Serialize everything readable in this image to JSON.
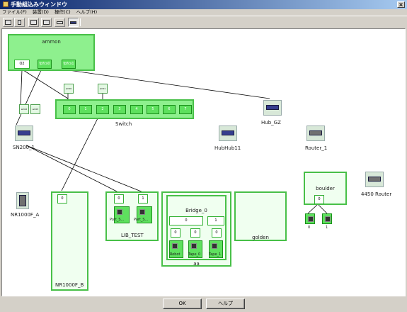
{
  "window": {
    "title": "手動組込みウィンドウ",
    "close": "×"
  },
  "menu": [
    "ファイル(F)",
    "装置(D)",
    "操作(C)",
    "ヘルプ(H)"
  ],
  "toolbar_icons": [
    "move-tool-icon",
    "pause-tool-icon",
    "list-tool-icon",
    "drive-tool-icon",
    "cartridge-tool-icon",
    "library-tool-icon"
  ],
  "diagram": {
    "ammon": {
      "label": "ammon",
      "ports": [
        "O2",
        "fpfcs0",
        "fpfcs1"
      ]
    },
    "switch": {
      "label": "Switch",
      "ports": [
        "0",
        "1",
        "2",
        "3",
        "4",
        "5",
        "6",
        "7"
      ]
    },
    "hub_gz": "Hub_GZ",
    "hubhub11": "HubHub11",
    "router_1": "Router_1",
    "sn200": "SN200_1",
    "boulder": {
      "label": "boulder",
      "port": "0",
      "child_ports": [
        "0",
        "1"
      ]
    },
    "router_4450": "4450 Router",
    "nr1000f_a": "NR1000F_A",
    "nr1000f_b": {
      "label": "NR1000F_B",
      "port": "0"
    },
    "lib_test": {
      "label": "LIB_TEST",
      "ports": [
        "0",
        "1"
      ],
      "devices": [
        "Port_S...",
        "Port_S..."
      ]
    },
    "aa": {
      "label": "aa",
      "bridge": "Bridge_0",
      "bridge_ports": [
        "0",
        "1"
      ],
      "ports": [
        "0",
        "0",
        "0"
      ],
      "devices": [
        "Robot",
        "Tape_0",
        "Tape_1"
      ]
    },
    "golden": "golden",
    "small_tags": [
      "sm00",
      "sm01",
      "sm02",
      "sm03"
    ]
  },
  "buttons": {
    "ok": "OK",
    "help": "ヘルプ"
  }
}
